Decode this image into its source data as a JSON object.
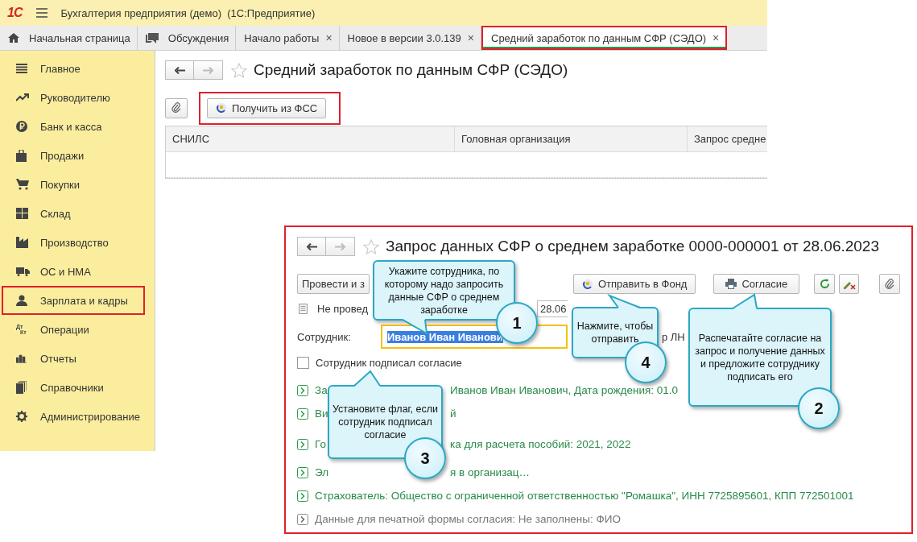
{
  "app": {
    "logo": "1С",
    "title": "Бухгалтерия предприятия (демо)  (1С:Предприятие)"
  },
  "tabs": [
    {
      "label": "Начальная страница",
      "kind": "home",
      "closable": false,
      "selected": false,
      "highlighted": false
    },
    {
      "label": "Обсуждения",
      "kind": "chat",
      "closable": false,
      "selected": false,
      "highlighted": false
    },
    {
      "label": "Начало работы",
      "kind": "plain",
      "closable": true,
      "selected": false,
      "highlighted": false
    },
    {
      "label": "Новое в версии 3.0.139",
      "kind": "plain",
      "closable": true,
      "selected": false,
      "highlighted": false
    },
    {
      "label": "Средний заработок по данным СФР (СЭДО)",
      "kind": "plain",
      "closable": true,
      "selected": true,
      "highlighted": true
    }
  ],
  "close_glyph": "×",
  "sidebar": {
    "items": [
      {
        "label": "Главное",
        "highlighted": false
      },
      {
        "label": "Руководителю",
        "highlighted": false
      },
      {
        "label": "Банк и касса",
        "highlighted": false
      },
      {
        "label": "Продажи",
        "highlighted": false
      },
      {
        "label": "Покупки",
        "highlighted": false
      },
      {
        "label": "Склад",
        "highlighted": false
      },
      {
        "label": "Производство",
        "highlighted": false
      },
      {
        "label": "ОС и НМА",
        "highlighted": false
      },
      {
        "label": "Зарплата и кадры",
        "highlighted": true
      },
      {
        "label": "Операции",
        "highlighted": false
      },
      {
        "label": "Отчеты",
        "highlighted": false
      },
      {
        "label": "Справочники",
        "highlighted": false
      },
      {
        "label": "Администрирование",
        "highlighted": false
      }
    ]
  },
  "dtkt_icon": {
    "top": "Дт",
    "bottom": "Кт"
  },
  "form": {
    "title": "Средний заработок по данным СФР (СЭДО)",
    "button": {
      "label": "Получить из ФСС",
      "highlighted": true
    },
    "table": {
      "columns": [
        "СНИЛС",
        "Головная организация",
        "Запрос средне"
      ]
    }
  },
  "document": {
    "title": "Запрос данных СФР о среднем заработке 0000-000001 от 28.06.2023",
    "post_button": "Провести и з",
    "send_button": "Отправить в Фонд",
    "consent_button": "Согласие",
    "status": "Не провед",
    "date": "28.06",
    "employee_label": "Сотрудник:",
    "employee_value": "Иванов Иван Иванови",
    "employee_tail": "р ЛН",
    "checkbox": {
      "label": "Сотрудник подписал согласие",
      "checked": false
    },
    "links": [
      {
        "parts": [
          "За",
          "Иванов Иван Иванович, Дата рождения: 01.0"
        ],
        "kind": "filled"
      },
      {
        "parts": [
          "Ви",
          "й"
        ],
        "kind": "filled"
      },
      {
        "parts": [
          "Го",
          "ка для расчета пособий: 2021, 2022"
        ],
        "kind": "filled"
      },
      {
        "parts": [
          "Эл",
          "я в организац…"
        ],
        "kind": "filled"
      },
      {
        "parts": [
          "Страхователь: Общество с ограниченной ответственностью \"Ромашка\", ИНН 7725895601, КПП 772501001"
        ],
        "kind": "filled"
      },
      {
        "parts": [
          "Данные для печатной формы согласия: Не заполнены: ФИО"
        ],
        "kind": "empty"
      }
    ]
  },
  "callouts": [
    {
      "number": "1",
      "text": "Укажите сотрудника, по которому надо запросить данные СФР о среднем заработке"
    },
    {
      "number": "4",
      "text": "Нажмите, чтобы отправить"
    },
    {
      "number": "2",
      "text": "Распечатайте согласие на запрос и получение данных и предложите сотруднику подписать его"
    },
    {
      "number": "3",
      "text": "Установите флаг, если сотрудник подписал согласие"
    }
  ]
}
